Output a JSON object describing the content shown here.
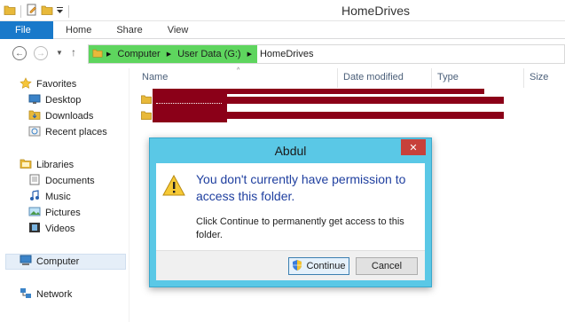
{
  "window": {
    "title": "HomeDrives"
  },
  "ribbon": {
    "tabs": [
      {
        "label": "File"
      },
      {
        "label": "Home"
      },
      {
        "label": "Share"
      },
      {
        "label": "View"
      }
    ]
  },
  "address": {
    "breadcrumbs": [
      {
        "label": "Computer"
      },
      {
        "label": "User Data (G:)"
      },
      {
        "label": "HomeDrives"
      }
    ]
  },
  "sidebar": {
    "favorites": {
      "label": "Favorites",
      "items": [
        {
          "label": "Desktop"
        },
        {
          "label": "Downloads"
        },
        {
          "label": "Recent places"
        }
      ]
    },
    "libraries": {
      "label": "Libraries",
      "items": [
        {
          "label": "Documents"
        },
        {
          "label": "Music"
        },
        {
          "label": "Pictures"
        },
        {
          "label": "Videos"
        }
      ]
    },
    "computer": {
      "label": "Computer"
    },
    "network": {
      "label": "Network"
    }
  },
  "file_list": {
    "columns": [
      {
        "label": "Name"
      },
      {
        "label": "Date modified"
      },
      {
        "label": "Type"
      },
      {
        "label": "Size"
      }
    ]
  },
  "dialog": {
    "title": "Abdul",
    "close_label": "✕",
    "message": "You don't currently have permission to access this folder.",
    "detail": "Click Continue to permanently get access to this folder.",
    "continue_label": "Continue",
    "cancel_label": "Cancel"
  },
  "colors": {
    "accent": "#1979ca",
    "dialog_frame": "#5ac8e6",
    "close_button": "#c7403a",
    "redaction": "#8b0018"
  }
}
